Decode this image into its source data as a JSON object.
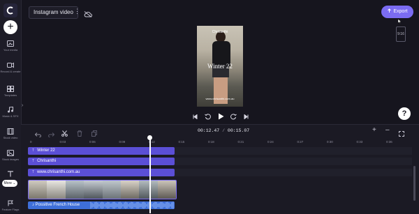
{
  "header": {
    "project_title": "Instagram video",
    "export_label": "Export",
    "aspect_ratio": "9:16"
  },
  "sidebar": {
    "items": [
      {
        "label": "Your media",
        "icon": "media-icon"
      },
      {
        "label": "Record & create",
        "icon": "record-icon"
      },
      {
        "label": "Templates",
        "icon": "templates-icon"
      },
      {
        "label": "Music & SFX",
        "icon": "music-icon"
      },
      {
        "label": "Stock video",
        "icon": "film-icon"
      },
      {
        "label": "Stock images",
        "icon": "image-icon"
      },
      {
        "label": "Text",
        "icon": "text-icon"
      },
      {
        "label": "Feature Flags",
        "icon": "flag-icon"
      }
    ],
    "more_label": "More"
  },
  "preview": {
    "name_text": "Chrisanthi",
    "title_text": "Winter 22",
    "url_text": "www.chrisanthi.com.au"
  },
  "help_label": "?",
  "timeline": {
    "current_time": "00:12.47",
    "separator": " / ",
    "total_time": "00:15.07",
    "ruler_ticks": [
      "0",
      "0:03",
      "0:06",
      "0:09",
      "0:12",
      "0:15",
      "0:18",
      "0:21",
      "0:24",
      "0:27",
      "0:30",
      "0:33",
      "0:36"
    ],
    "tracks": [
      {
        "label": "Winter 22"
      },
      {
        "label": "Chrisanthi"
      },
      {
        "label": "www.chrisanthi.com.au"
      }
    ],
    "audio_label": "Possitive French House"
  },
  "colors": {
    "accent": "#7b6cf2",
    "text_track": "#5b4fd6",
    "audio_track": "#3e6fd9",
    "background": "#16151e"
  }
}
